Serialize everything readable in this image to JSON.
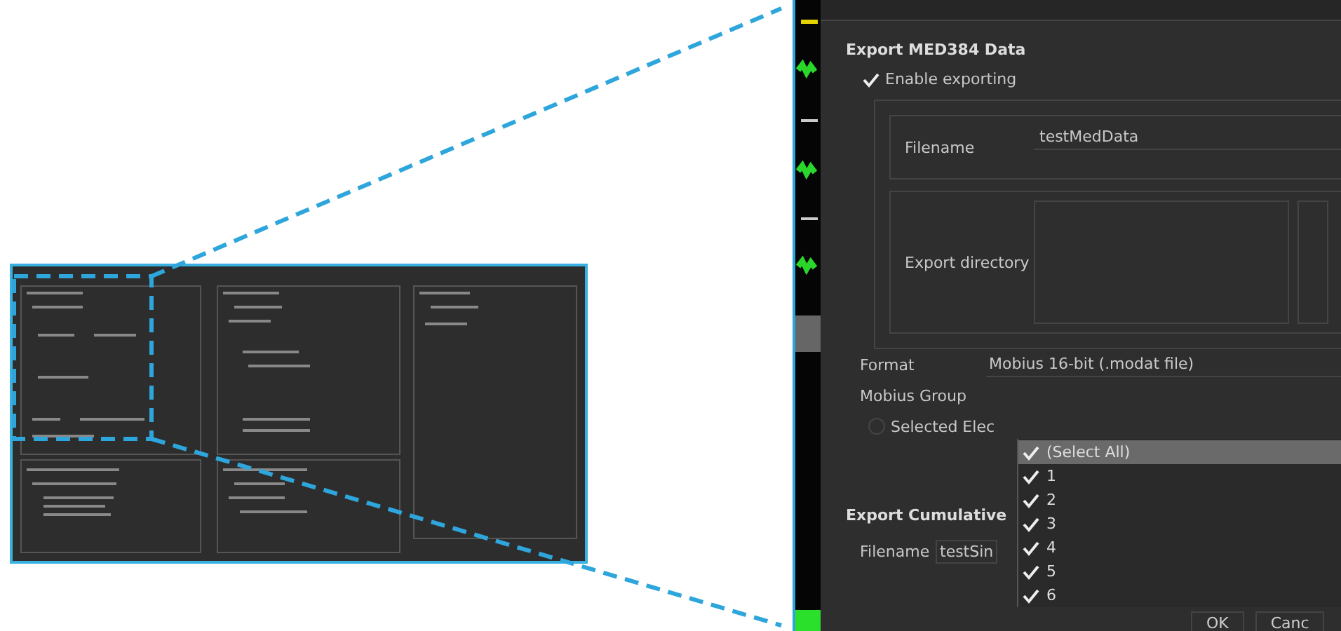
{
  "zoom_view": {
    "section_title": "Export MED384 Data",
    "enable_exporting": {
      "label": "Enable exporting",
      "checked": true
    },
    "filename": {
      "label": "Filename",
      "value": "testMedData"
    },
    "export_directory": {
      "label": "Export directory"
    },
    "format": {
      "label": "Format",
      "value": "Mobius 16-bit (.modat file)"
    },
    "mobius_group": {
      "label": "Mobius Group"
    },
    "selected_electrodes": {
      "label": "Selected Elec",
      "checked": false
    },
    "electrode_list": [
      {
        "label": "(Select All)",
        "checked": true,
        "selected": true
      },
      {
        "label": "1",
        "checked": true,
        "selected": false
      },
      {
        "label": "2",
        "checked": true,
        "selected": false
      },
      {
        "label": "3",
        "checked": true,
        "selected": false
      },
      {
        "label": "4",
        "checked": true,
        "selected": false
      },
      {
        "label": "5",
        "checked": true,
        "selected": false
      },
      {
        "label": "6",
        "checked": true,
        "selected": false
      }
    ],
    "cumulative_title": "Export Cumulative",
    "cumulative_filename": {
      "label": "Filename",
      "value": "testSin"
    },
    "buttons": [
      "OK",
      "Canc"
    ]
  }
}
